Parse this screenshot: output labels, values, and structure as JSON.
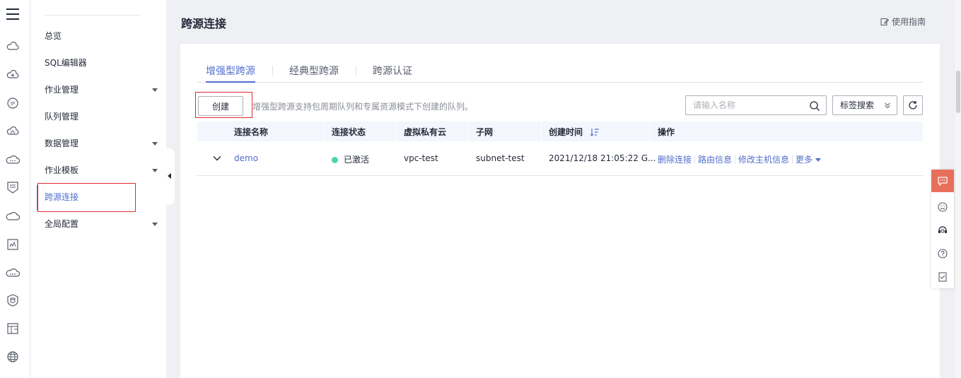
{
  "rail": {
    "icons": [
      "menu-icon",
      "cloud-icon",
      "cloud-upload-icon",
      "ip-icon",
      "cloud-home-icon",
      "cloud-dots-icon",
      "shield-list-icon",
      "cloud-flat-icon",
      "chart-box-icon",
      "cloud-network-icon",
      "shield-db-icon",
      "layout-icon",
      "globe-icon"
    ]
  },
  "subnav": {
    "items": [
      {
        "label": "总览",
        "expandable": false
      },
      {
        "label": "SQL编辑器",
        "expandable": false
      },
      {
        "label": "作业管理",
        "expandable": true
      },
      {
        "label": "队列管理",
        "expandable": false
      },
      {
        "label": "数据管理",
        "expandable": true
      },
      {
        "label": "作业模板",
        "expandable": true
      },
      {
        "label": "跨源连接",
        "expandable": false,
        "active": true
      },
      {
        "label": "全局配置",
        "expandable": true
      }
    ]
  },
  "header": {
    "title": "跨源连接",
    "guide_label": "使用指南"
  },
  "tabs": [
    {
      "label": "增强型跨源",
      "active": true
    },
    {
      "label": "经典型跨源",
      "active": false
    },
    {
      "label": "跨源认证",
      "active": false
    }
  ],
  "toolbar": {
    "create_label": "创建",
    "tip": "增强型跨源支持包周期队列和专属资源模式下创建的队列。",
    "search_placeholder": "请输入名称",
    "tag_search_label": "标签搜索"
  },
  "table": {
    "columns": [
      "连接名称",
      "连接状态",
      "虚拟私有云",
      "子网",
      "创建时间",
      "操作"
    ],
    "rows": [
      {
        "name": "demo",
        "status": "已激活",
        "vpc": "vpc-test",
        "subnet": "subnet-test",
        "created": "2021/12/18 21:05:22 G...",
        "actions": [
          "删除连接",
          "路由信息",
          "修改主机信息",
          "更多"
        ]
      }
    ]
  },
  "colors": {
    "accent": "#526ecc",
    "status_active": "#50d4ab",
    "highlight": "#e02a36",
    "chat": "#e7705b"
  }
}
